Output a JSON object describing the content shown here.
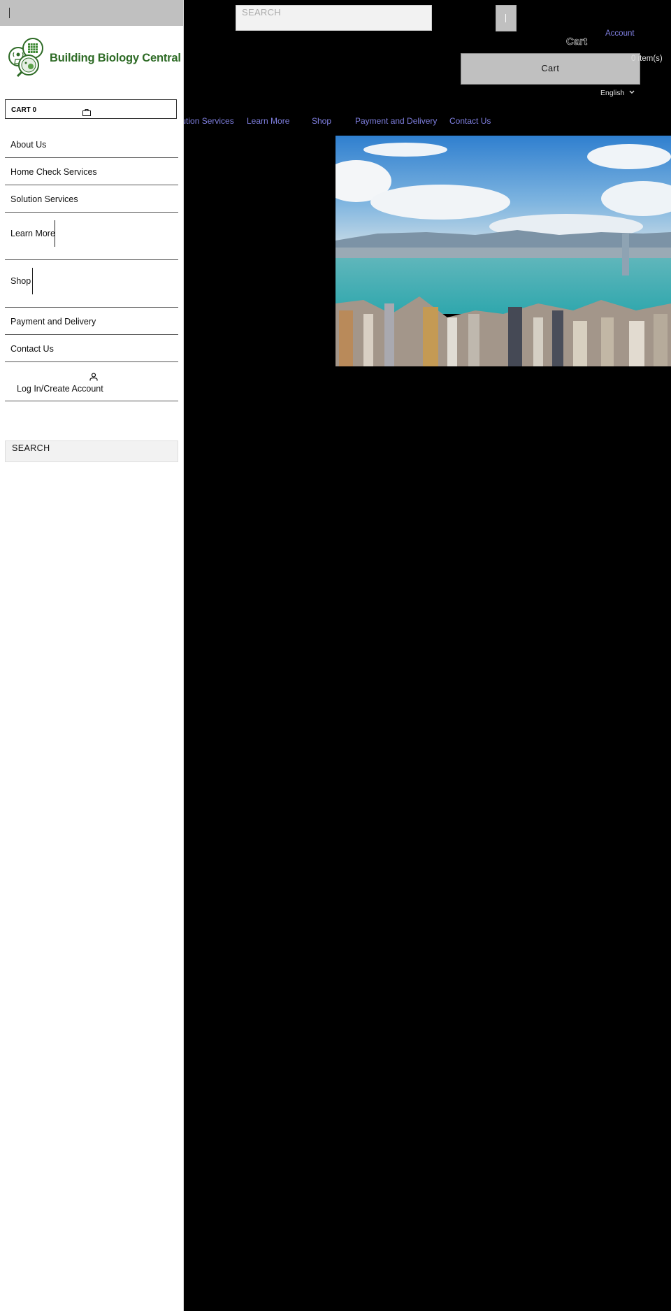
{
  "drawer": {
    "logo_text": "Building Biology Central",
    "cart_label": "CART 0",
    "nav_items": [
      {
        "label": "About Us"
      },
      {
        "label": "Home Check Services"
      },
      {
        "label": "Solution Services"
      },
      {
        "label": "Learn More"
      },
      {
        "label": "Shop"
      },
      {
        "label": "Payment and Delivery"
      },
      {
        "label": "Contact Us"
      }
    ],
    "login_label": "Log In/Create Account",
    "search_label": "SEARCH"
  },
  "header": {
    "search_placeholder": "SEARCH",
    "account_label": "Account",
    "cart_heading": "Cart",
    "cart_button_label": "Cart",
    "cart_count": "0 item(s)",
    "language": "English"
  },
  "top_nav": [
    {
      "label": "Solution Services"
    },
    {
      "label": "Learn More"
    },
    {
      "label": "Shop"
    },
    {
      "label": "Payment and Delivery"
    },
    {
      "label": "Contact Us"
    }
  ],
  "hero": {
    "alt": "Hong Kong Victoria Harbour skyline"
  },
  "colors": {
    "brand_green": "#2e6b26",
    "link_purple": "#7f7fe0",
    "drawer_top": "#c0c0c0",
    "background": "#000000"
  }
}
